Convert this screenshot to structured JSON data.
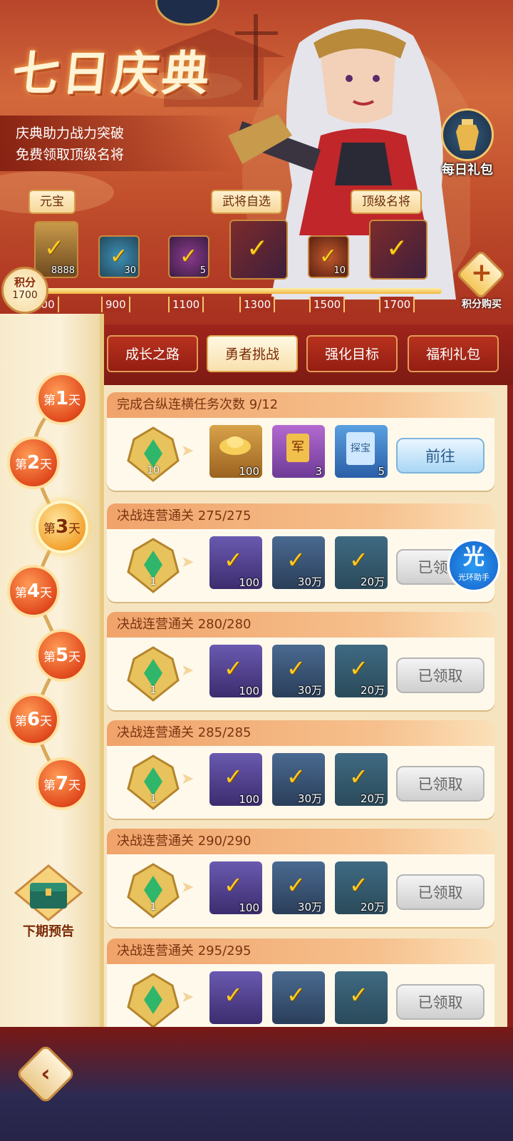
{
  "banner": {
    "title": "七日庆典",
    "subtitle_line1": "庆典助力战力突破",
    "subtitle_line2": "免费领取顶级名将",
    "daily_gift_label": "每日礼包",
    "reward_labels": [
      "元宝",
      "武将自选",
      "顶级名将"
    ],
    "milestone_rewards": [
      {
        "count": "8888",
        "icon": "ingot-icon"
      },
      {
        "count": "30",
        "icon": "orb-icon"
      },
      {
        "count": "5",
        "icon": "potion-icon"
      },
      {
        "count": "",
        "icon": "general-choice-book-icon"
      },
      {
        "count": "10",
        "icon": "scroll-icon"
      },
      {
        "count": "",
        "icon": "top-general-book-icon"
      }
    ],
    "milestones": [
      "700",
      "900",
      "1100",
      "1300",
      "1500",
      "1700"
    ],
    "score_label": "积分",
    "score_value": "1700",
    "buy_points_label": "积分购买",
    "buy_points_symbol": "+"
  },
  "days": [
    {
      "prefix": "第",
      "num": "1",
      "suffix": "天"
    },
    {
      "prefix": "第",
      "num": "2",
      "suffix": "天"
    },
    {
      "prefix": "第",
      "num": "3",
      "suffix": "天"
    },
    {
      "prefix": "第",
      "num": "4",
      "suffix": "天"
    },
    {
      "prefix": "第",
      "num": "5",
      "suffix": "天"
    },
    {
      "prefix": "第",
      "num": "6",
      "suffix": "天"
    },
    {
      "prefix": "第",
      "num": "7",
      "suffix": "天"
    }
  ],
  "active_day": 3,
  "preview_label": "下期预告",
  "tabs": [
    "成长之路",
    "勇者挑战",
    "强化目标",
    "福利礼包"
  ],
  "active_tab": 1,
  "tasks": [
    {
      "title": "完成合纵连横任务次数 9/12",
      "emblem_count": "10",
      "items": [
        {
          "count": "100"
        },
        {
          "count": "3"
        },
        {
          "count": "5"
        }
      ],
      "button": "前往"
    },
    {
      "title": "决战连营通关 275/275",
      "emblem_count": "1",
      "items": [
        {
          "count": "100"
        },
        {
          "count": "30万"
        },
        {
          "count": "20万"
        }
      ],
      "button": "已领取"
    },
    {
      "title": "决战连营通关 280/280",
      "emblem_count": "1",
      "items": [
        {
          "count": "100"
        },
        {
          "count": "30万"
        },
        {
          "count": "20万"
        }
      ],
      "button": "已领取"
    },
    {
      "title": "决战连营通关 285/285",
      "emblem_count": "1",
      "items": [
        {
          "count": "100"
        },
        {
          "count": "30万"
        },
        {
          "count": "20万"
        }
      ],
      "button": "已领取"
    },
    {
      "title": "决战连营通关 290/290",
      "emblem_count": "1",
      "items": [
        {
          "count": "100"
        },
        {
          "count": "30万"
        },
        {
          "count": "20万"
        }
      ],
      "button": "已领取"
    },
    {
      "title": "决战连营通关 295/295",
      "emblem_count": "",
      "items": [
        {
          "count": ""
        },
        {
          "count": ""
        },
        {
          "count": ""
        }
      ],
      "button": "已领取"
    }
  ],
  "helper": {
    "glyph": "光",
    "label": "光环助手"
  },
  "item_glyphs": {
    "token": "军",
    "explore": "探宝"
  },
  "colors": {
    "accent": "#e14a1e",
    "gold": "#f2c66b",
    "panel": "#f6e4c1",
    "go_button": "#a9d6f5"
  }
}
